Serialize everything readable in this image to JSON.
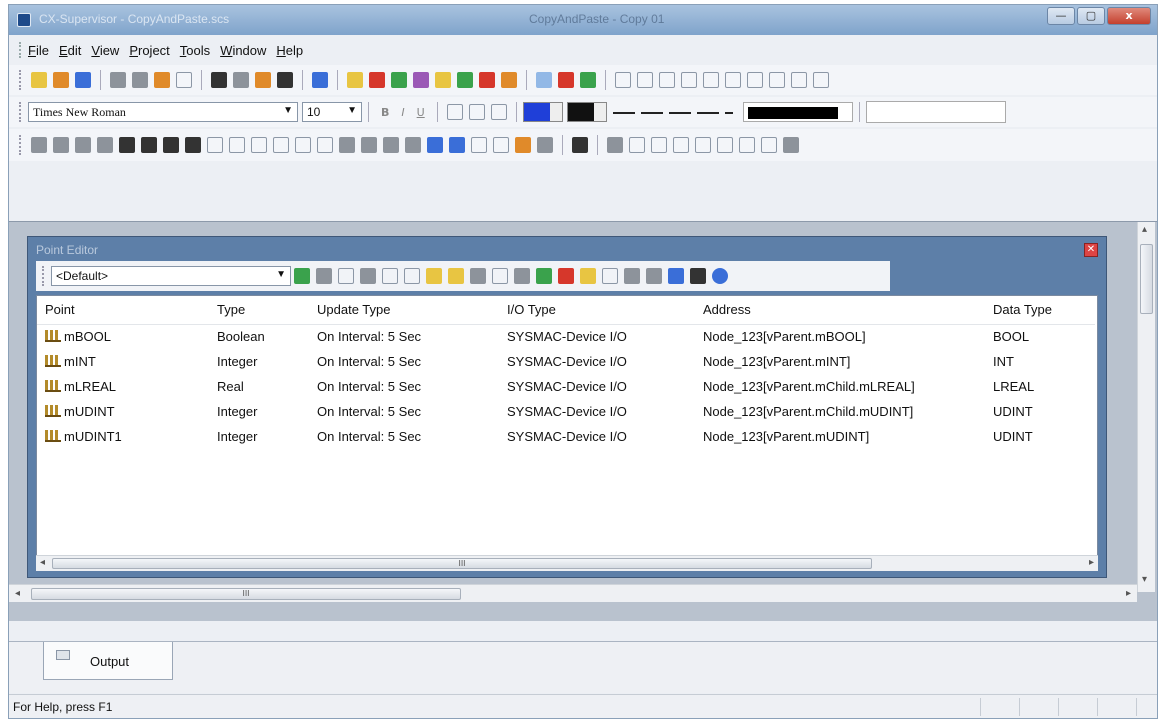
{
  "window": {
    "title": "CX-Supervisor - CopyAndPaste.scs",
    "center_title": "CopyAndPaste - Copy 01",
    "minimize": "—",
    "maximize": "▢",
    "close": "x"
  },
  "menu": [
    {
      "key": "F",
      "rest": "ile"
    },
    {
      "key": "E",
      "rest": "dit"
    },
    {
      "key": "V",
      "rest": "iew"
    },
    {
      "key": "P",
      "rest": "roject"
    },
    {
      "key": "T",
      "rest": "ools"
    },
    {
      "key": "W",
      "rest": "indow"
    },
    {
      "key": "H",
      "rest": "elp"
    }
  ],
  "format_toolbar": {
    "font": "Times New Roman",
    "size": "10",
    "bold": "B",
    "italic": "I",
    "underline": "U"
  },
  "point_editor": {
    "title": "Point Editor",
    "filter": "<Default>",
    "columns": [
      "Point",
      "Type",
      "Update Type",
      "I/O Type",
      "Address",
      "Data Type"
    ],
    "rows": [
      [
        "mBOOL",
        "Boolean",
        "On Interval: 5 Sec",
        "SYSMAC-Device I/O",
        "Node_123[vParent.mBOOL]",
        "BOOL"
      ],
      [
        "mINT",
        "Integer",
        "On Interval: 5 Sec",
        "SYSMAC-Device I/O",
        "Node_123[vParent.mINT]",
        "INT"
      ],
      [
        "mLREAL",
        "Real",
        "On Interval: 5 Sec",
        "SYSMAC-Device I/O",
        "Node_123[vParent.mChild.mLREAL]",
        "LREAL"
      ],
      [
        "mUDINT",
        "Integer",
        "On Interval: 5 Sec",
        "SYSMAC-Device I/O",
        "Node_123[vParent.mChild.mUDINT]",
        "UDINT"
      ],
      [
        "mUDINT1",
        "Integer",
        "On Interval: 5 Sec",
        "SYSMAC-Device I/O",
        "Node_123[vParent.mUDINT]",
        "UDINT"
      ]
    ]
  },
  "scroll_thumb_label": "III",
  "output_tab": "Output",
  "status_text": "For Help, press F1"
}
